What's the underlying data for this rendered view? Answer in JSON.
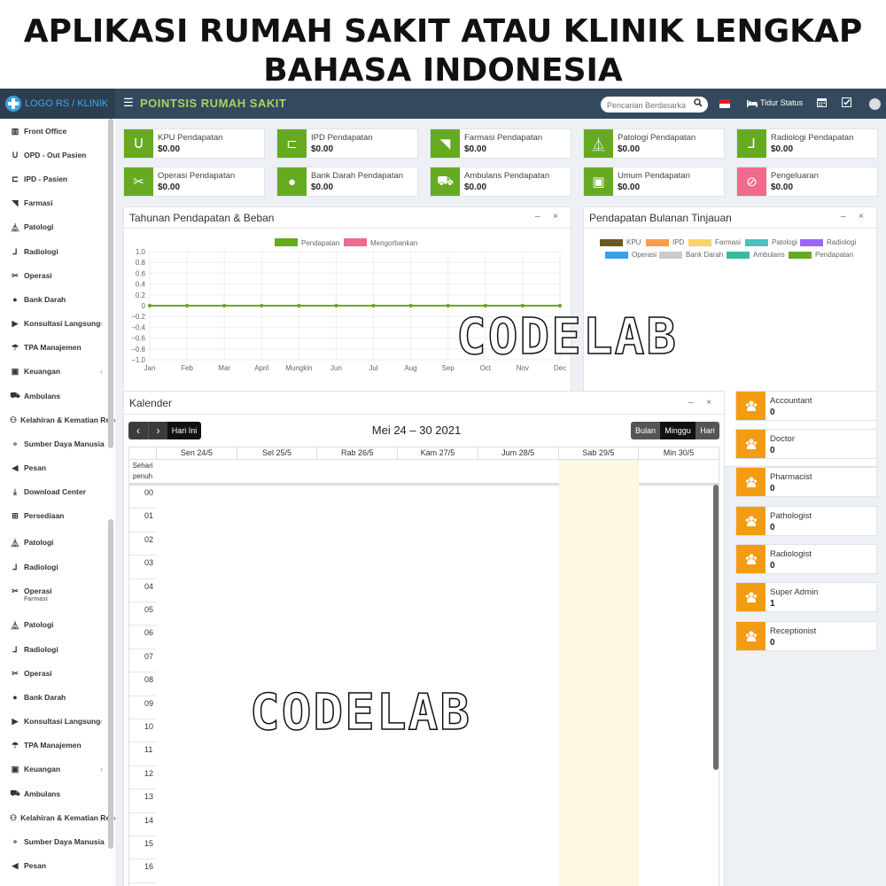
{
  "banner": {
    "line1": "APLIKASI RUMAH SAKIT ATAU KLINIK LENGKAP",
    "line2": "BAHASA INDONESIA"
  },
  "topbar": {
    "logo": "LOGO RS / KLINIK",
    "title": "POINTSIS RUMAH SAKIT",
    "search_placeholder": "Pencarian Berdasarka",
    "bed_status": "Tidur Status"
  },
  "sidebar": {
    "items": [
      {
        "label": "Front Office",
        "icon": "building-icon",
        "chevron": false
      },
      {
        "label": "OPD - Out Pasien",
        "icon": "stethoscope-icon",
        "chevron": false
      },
      {
        "label": "IPD - Pasien",
        "icon": "bed-icon",
        "chevron": false
      },
      {
        "label": "Farmasi",
        "icon": "mortar-icon",
        "chevron": false
      },
      {
        "label": "Patologi",
        "icon": "flask-icon",
        "chevron": false
      },
      {
        "label": "Radiologi",
        "icon": "microscope-icon",
        "chevron": false
      },
      {
        "label": "Operasi",
        "icon": "scissors-icon",
        "chevron": false
      },
      {
        "label": "Bank Darah",
        "icon": "tint-icon",
        "chevron": false
      },
      {
        "label": "Konsultasi Langsung",
        "icon": "video-icon",
        "chevron": true
      },
      {
        "label": "TPA Manajemen",
        "icon": "umbrella-icon",
        "chevron": false
      },
      {
        "label": "Keuangan",
        "icon": "money-icon",
        "chevron": true
      },
      {
        "label": "Ambulans",
        "icon": "ambulance-icon",
        "chevron": false
      },
      {
        "label": "Kelahiran & Kematian Reco",
        "icon": "family-icon",
        "chevron": false
      },
      {
        "label": "Sumber Daya Manusia",
        "icon": "sitemap-icon",
        "chevron": false
      },
      {
        "label": "Pesan",
        "icon": "bullhorn-icon",
        "chevron": false
      },
      {
        "label": "Download Center",
        "icon": "download-icon",
        "chevron": false
      },
      {
        "label": "Persediaan",
        "icon": "inventory-icon",
        "chevron": false
      },
      {
        "label": "Patologi",
        "icon": "flask-icon",
        "chevron": false
      },
      {
        "label": "Radiologi",
        "icon": "microscope-icon",
        "chevron": false
      },
      {
        "label": "Operasi",
        "icon": "scissors-icon",
        "chevron": false
      },
      {
        "label": "Patologi",
        "icon": "flask-icon",
        "chevron": false
      },
      {
        "label": "Radiologi",
        "icon": "microscope-icon",
        "chevron": false
      },
      {
        "label": "Operasi",
        "icon": "scissors-icon",
        "chevron": false
      },
      {
        "label": "Bank Darah",
        "icon": "tint-icon",
        "chevron": false
      },
      {
        "label": "Konsultasi Langsung",
        "icon": "video-icon",
        "chevron": true
      },
      {
        "label": "TPA Manajemen",
        "icon": "umbrella-icon",
        "chevron": false
      },
      {
        "label": "Keuangan",
        "icon": "money-icon",
        "chevron": true
      },
      {
        "label": "Ambulans",
        "icon": "ambulance-icon",
        "chevron": false
      },
      {
        "label": "Kelahiran & Kematian Reco",
        "icon": "family-icon",
        "chevron": false
      },
      {
        "label": "Sumber Daya Manusia",
        "icon": "sitemap-icon",
        "chevron": false
      },
      {
        "label": "Pesan",
        "icon": "bullhorn-icon",
        "chevron": false
      }
    ],
    "overlap_fragment": "Farmasi"
  },
  "stats": [
    {
      "label": "KPU Pendapatan",
      "value": "$0.00",
      "icon": "stethoscope-icon",
      "color": "#66aa22"
    },
    {
      "label": "IPD Pendapatan",
      "value": "$0.00",
      "icon": "bed-icon",
      "color": "#66aa22"
    },
    {
      "label": "Farmasi Pendapatan",
      "value": "$0.00",
      "icon": "mortar-icon",
      "color": "#66aa22"
    },
    {
      "label": "Patologi Pendapatan",
      "value": "$0.00",
      "icon": "flask-icon",
      "color": "#66aa22"
    },
    {
      "label": "Radiologi Pendapatan",
      "value": "$0.00",
      "icon": "microscope-icon",
      "color": "#66aa22"
    },
    {
      "label": "Operasi Pendapatan",
      "value": "$0.00",
      "icon": "scissors-icon",
      "color": "#66aa22"
    },
    {
      "label": "Bank Darah Pendapatan",
      "value": "$0.00",
      "icon": "tint-icon",
      "color": "#66aa22"
    },
    {
      "label": "Ambulans Pendapatan",
      "value": "$0.00",
      "icon": "ambulance-icon",
      "color": "#66aa22"
    },
    {
      "label": "Umum Pendapatan",
      "value": "$0.00",
      "icon": "money-icon",
      "color": "#66aa22"
    },
    {
      "label": "Pengeluaran",
      "value": "$0.00",
      "icon": "expense-icon",
      "color": "#f06a8c"
    }
  ],
  "yearly_panel": {
    "title": "Tahunan Pendapatan & Beban",
    "controls": "– ×"
  },
  "monthly_panel": {
    "title": "Pendapatan Bulanan Tinjauan",
    "controls": "– ×",
    "legend": [
      {
        "name": "KPU",
        "color": "#6b5a1e"
      },
      {
        "name": "IPD",
        "color": "#f4a04a"
      },
      {
        "name": "Farmasi",
        "color": "#f9d566"
      },
      {
        "name": "Patologi",
        "color": "#4bc0c0"
      },
      {
        "name": "Radiologi",
        "color": "#9966ff"
      },
      {
        "name": "Operasi",
        "color": "#36a2eb"
      },
      {
        "name": "Bank Darah",
        "color": "#c9cbcf"
      },
      {
        "name": "Ambulans",
        "color": "#3cba9f"
      },
      {
        "name": "Pendapatan",
        "color": "#66aa22"
      }
    ]
  },
  "chart_data": {
    "type": "line",
    "categories": [
      "Jan",
      "Feb",
      "Mar",
      "April",
      "Mungkin",
      "Jun",
      "Jul",
      "Aug",
      "Sep",
      "Oct",
      "Nov",
      "Dec"
    ],
    "series": [
      {
        "name": "Pendapatan",
        "color": "#66aa22",
        "values": [
          0,
          0,
          0,
          0,
          0,
          0,
          0,
          0,
          0,
          0,
          0,
          0
        ]
      },
      {
        "name": "Mengorbankan",
        "color": "#f06a8c",
        "values": [
          0,
          0,
          0,
          0,
          0,
          0,
          0,
          0,
          0,
          0,
          0,
          0
        ]
      }
    ],
    "yticks": [
      "1.0",
      "0.8",
      "0.6",
      "0.4",
      "0.2",
      "0",
      "−0.2",
      "−0.4",
      "−0.6",
      "−0.8",
      "−1.0"
    ],
    "ylim": [
      -1,
      1
    ],
    "grid": true,
    "legend": "top-center"
  },
  "calendar": {
    "title": "Kalender",
    "controls": "– ×",
    "range": "Mei 24 – 30 2021",
    "prev": "‹",
    "next": "›",
    "today": "Hari Ini",
    "views": [
      "Bulan",
      "Minggu",
      "Hari"
    ],
    "allday": "Sehari penuh",
    "days": [
      "Sen 24/5",
      "Sel 25/5",
      "Rab 26/5",
      "Kam 27/5",
      "Jum 28/5",
      "Sab 29/5",
      "Min 30/5"
    ],
    "hours": [
      "00",
      "01",
      "02",
      "03",
      "04",
      "05",
      "06",
      "07",
      "08",
      "09",
      "10",
      "11",
      "12",
      "13",
      "14",
      "15",
      "16"
    ]
  },
  "staff": [
    {
      "label": "Accountant",
      "value": "0"
    },
    {
      "label": "Doctor",
      "value": "0"
    },
    {
      "label": "Pharmacist",
      "value": "0"
    },
    {
      "label": "Pathologist",
      "value": "0"
    },
    {
      "label": "Radiologist",
      "value": "0"
    },
    {
      "label": "Super Admin",
      "value": "1"
    },
    {
      "label": "Receptionist",
      "value": "0"
    }
  ],
  "watermark": "CODELAB"
}
